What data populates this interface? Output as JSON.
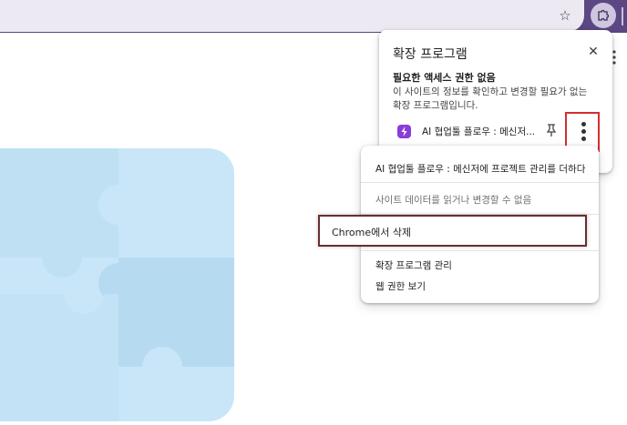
{
  "toolbar": {
    "star_icon": "star-icon",
    "extensions_icon": "puzzle-icon"
  },
  "panel": {
    "title": "확장 프로그램",
    "close_icon": "close-icon",
    "heading": "필요한 액세스 권한 없음",
    "description": "이 사이트의 정보를 확인하고 변경할 필요가 없는 확장 프로그램입니다.",
    "extension": {
      "name": "AI 협업툴 플로우 : 메신저...",
      "icon_color": "#8a3dd6"
    }
  },
  "context_menu": {
    "title": "AI 협업툴 플로우 : 메신저에 프로젝트 관리를 더하다",
    "site_data": "사이트 데이터를 읽거나 변경할 수 없음",
    "remove": "Chrome에서 삭제",
    "manage": "확장 프로그램 관리",
    "permissions": "웹 권한 보기"
  },
  "colors": {
    "toolbar": "#5b4783",
    "highlight_border": "#d32f2f",
    "puzzle": "#bfe0f3"
  }
}
